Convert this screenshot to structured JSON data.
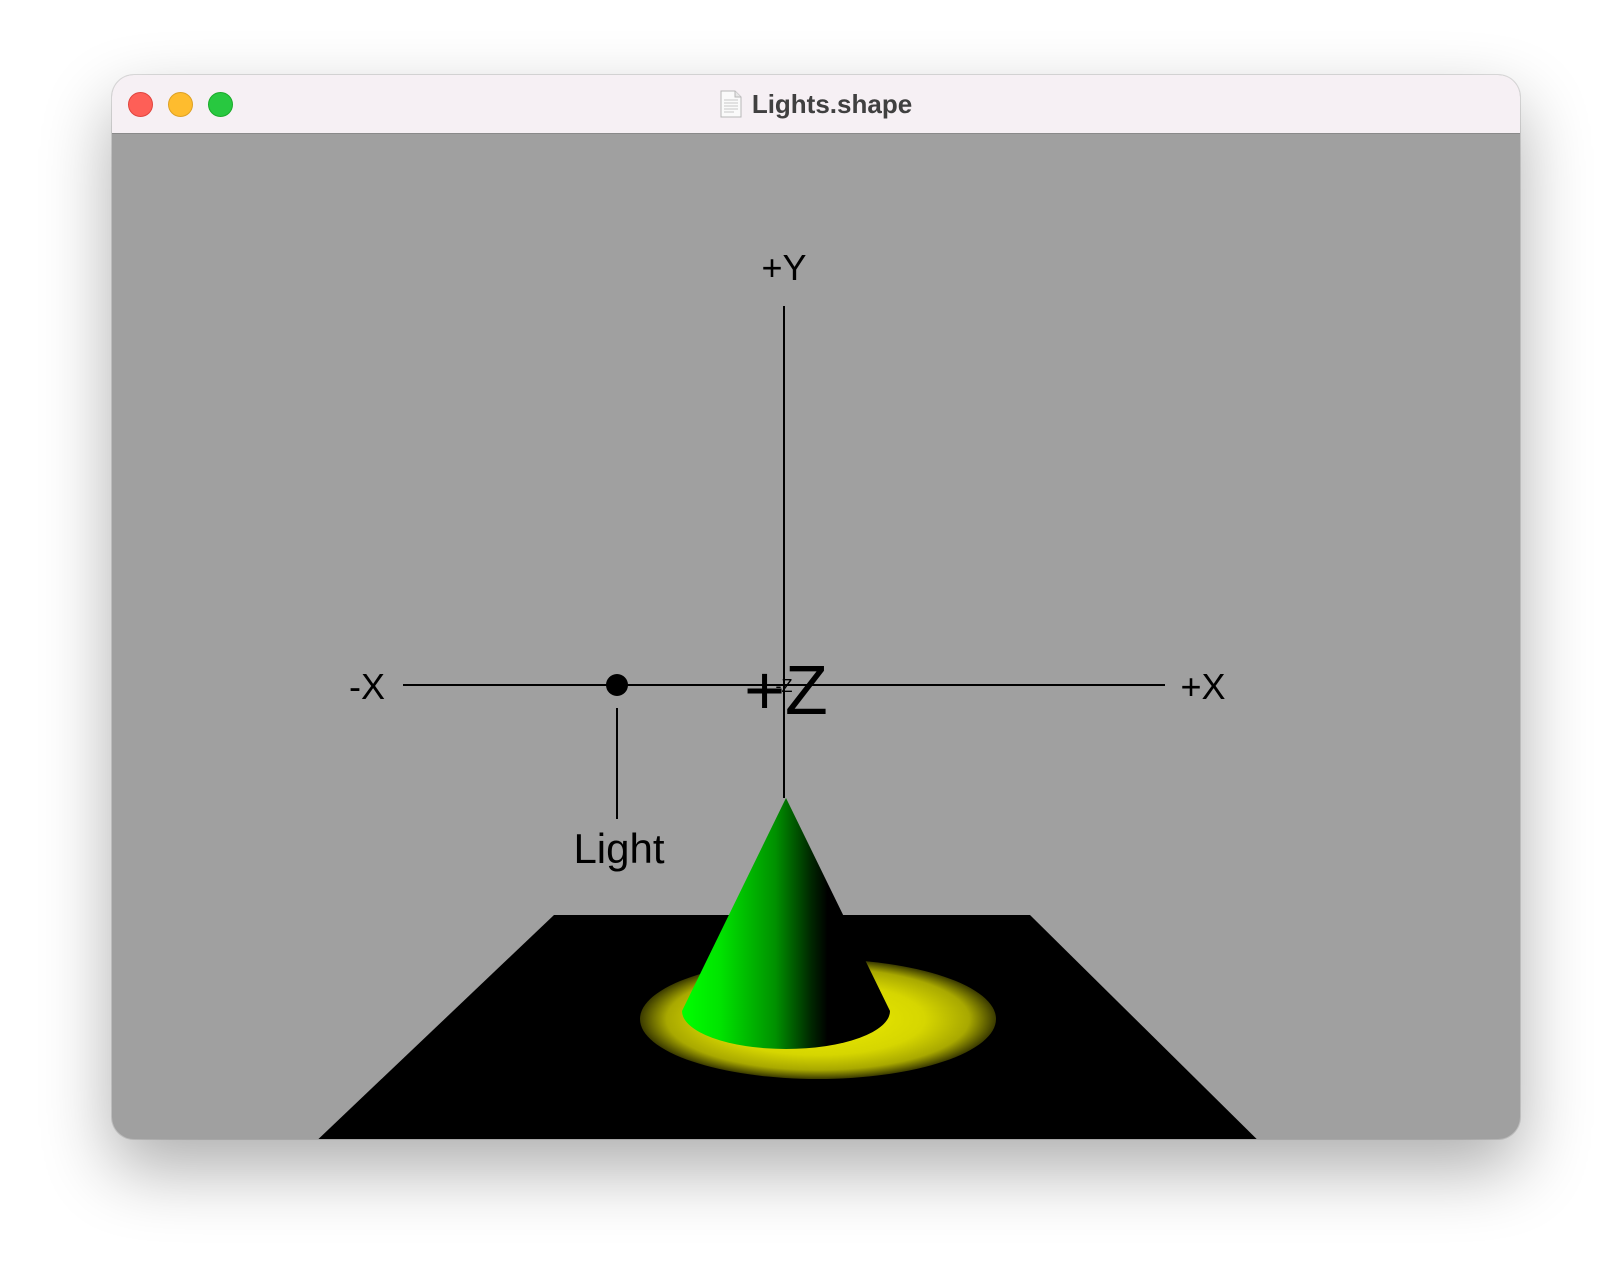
{
  "window": {
    "title": "Lights.shape",
    "controls": {
      "close": "close-button",
      "minimize": "minimize-button",
      "zoom": "zoom-button"
    }
  },
  "scene": {
    "background_color": "#a0a0a0",
    "axes": {
      "plus_y": "+Y",
      "minus_x": "-X",
      "plus_x": "+X",
      "plus_z": "+Z",
      "minus_z": "-Z"
    },
    "light_label": "Light",
    "colors": {
      "floor": "#000000",
      "cone": "#00ff00",
      "spotlight": "#e6e600"
    }
  }
}
